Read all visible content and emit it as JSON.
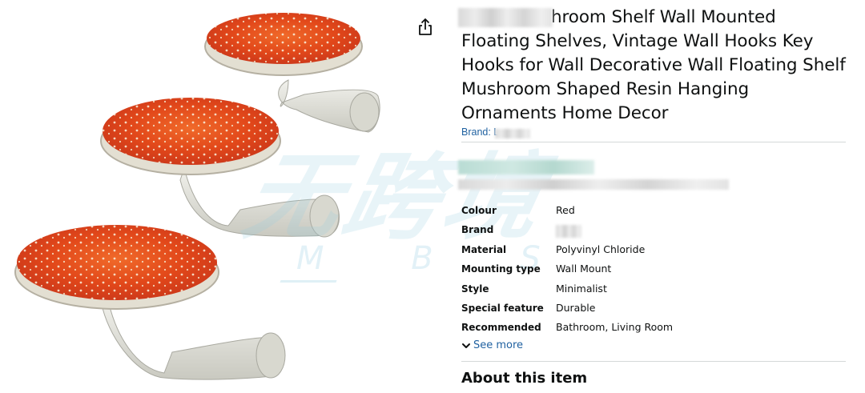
{
  "product": {
    "title": "Mushroom Shelf Wall Mounted Floating Shelves, Vintage Wall Hooks Key Hooks for Wall Decorative Wall Floating Shelf Mushroom Shaped Resin Hanging Ornaments Home Decor",
    "title_visible": "hroom Shelf Wall Mounted Floating Shelves, Vintage Wall Hooks Key Hooks for Wall Decorative Wall Floating Shelf Mushroom Shaped Resin Hanging Ornaments Home Decor",
    "brand_label": "Brand: L",
    "share_icon": "share-icon"
  },
  "specs": [
    {
      "key": "Colour",
      "value": "Red"
    },
    {
      "key": "Brand",
      "value": ""
    },
    {
      "key": "Material",
      "value": "Polyvinyl Chloride"
    },
    {
      "key": "Mounting type",
      "value": "Wall Mount"
    },
    {
      "key": "Style",
      "value": "Minimalist"
    },
    {
      "key": "Special feature",
      "value": "Durable"
    },
    {
      "key": "Recommended",
      "value": "Bathroom, Living Room"
    }
  ],
  "see_more_label": "See more",
  "about_heading": "About this item",
  "watermark": {
    "cn": "无跨境",
    "en": "M B S"
  },
  "colors": {
    "link": "#2162a1",
    "text": "#0f1111",
    "divider": "#d5d9d9",
    "cap_red": "#e2481a",
    "stem": "#e4e4dc"
  }
}
